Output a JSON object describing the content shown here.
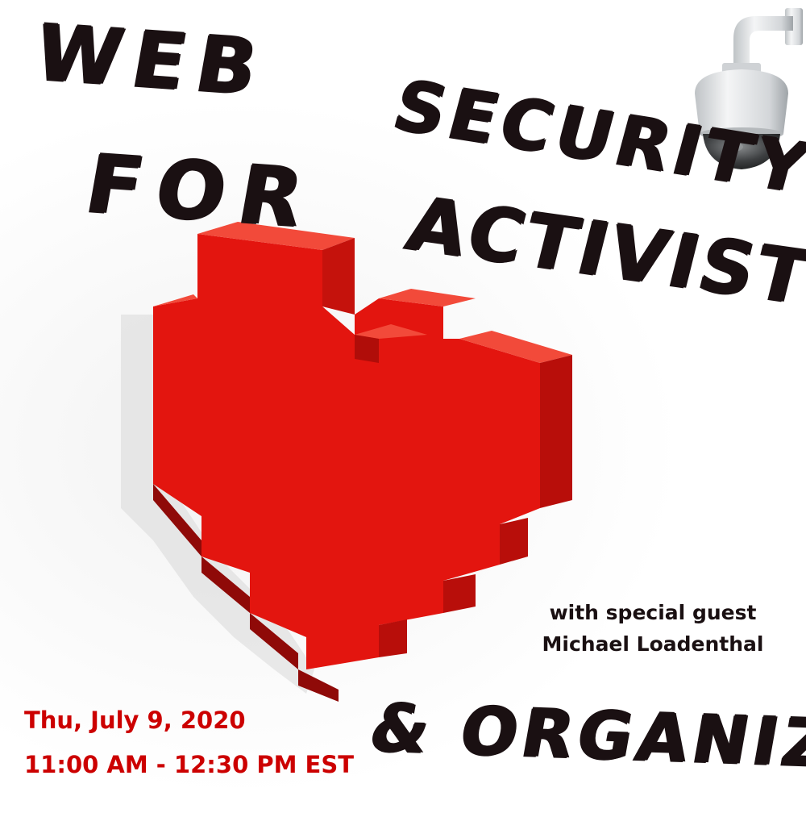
{
  "title": {
    "line1": "Web",
    "line2": "Security",
    "line3": "For",
    "line4": "Activists",
    "line5": "& Organizers"
  },
  "guest": {
    "line1": "with special guest",
    "line2": "Michael Loadenthal"
  },
  "event": {
    "date": "Thu, July 9, 2020",
    "time": "11:00 AM - 12:30 PM EST"
  },
  "colors": {
    "heart_red": "#e3150f",
    "date_red": "#cc0000",
    "title_ink": "#1a1012"
  },
  "icons": [
    "pixel-heart-icon",
    "security-camera-icon"
  ]
}
